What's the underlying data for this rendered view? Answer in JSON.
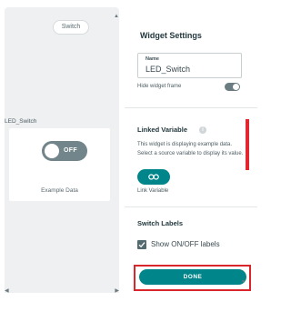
{
  "canvas": {
    "chip_label": "Switch",
    "widget": {
      "title": "LED_Switch",
      "toggle_label": "OFF",
      "caption": "Example Data"
    }
  },
  "settings": {
    "title": "Widget Settings",
    "name_label": "Name",
    "name_value": "LED_Switch",
    "hide_frame_label": "Hide widget frame",
    "linked_variable": {
      "title": "Linked Variable",
      "description": "This widget is displaying example data. Select a source variable to display its value.",
      "button_label": "Link Variable"
    },
    "switch_labels": {
      "title": "Switch Labels",
      "checkbox_label": "Show ON/OFF labels",
      "checked": true
    },
    "done_label": "DONE"
  },
  "colors": {
    "accent": "#00868a",
    "highlight": "#e0282e",
    "canvas_bg": "#eef0f1",
    "toggle_off": "#72858a"
  },
  "icons": [
    "chevron-up-icon",
    "chevron-left-icon",
    "chevron-right-icon",
    "info-icon",
    "link-icon",
    "checkmark-icon",
    "chevron-down-icon"
  ]
}
